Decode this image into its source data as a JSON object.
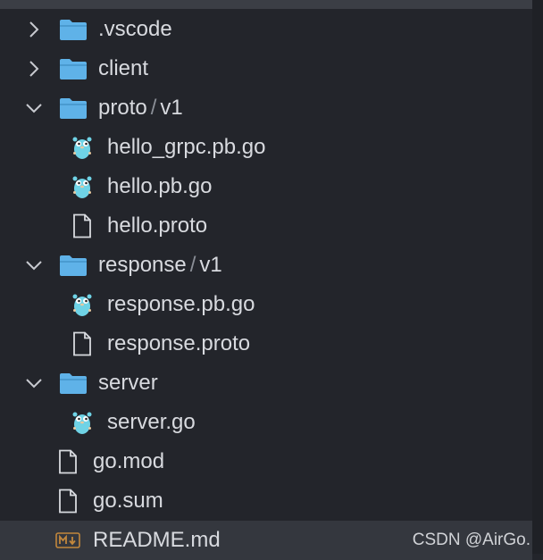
{
  "explorer": {
    "items": [
      {
        "label": ".vscode",
        "type": "folder",
        "expanded": false
      },
      {
        "label": "client",
        "type": "folder",
        "expanded": false
      },
      {
        "label": "proto",
        "sub": "v1",
        "type": "folder",
        "expanded": true
      },
      {
        "label": "hello_grpc.pb.go",
        "type": "go-file"
      },
      {
        "label": "hello.pb.go",
        "type": "go-file"
      },
      {
        "label": "hello.proto",
        "type": "file"
      },
      {
        "label": "response",
        "sub": "v1",
        "type": "folder",
        "expanded": true
      },
      {
        "label": "response.pb.go",
        "type": "go-file"
      },
      {
        "label": "response.proto",
        "type": "file"
      },
      {
        "label": "server",
        "type": "folder",
        "expanded": true
      },
      {
        "label": "server.go",
        "type": "go-file"
      },
      {
        "label": "go.mod",
        "type": "file"
      },
      {
        "label": "go.sum",
        "type": "file"
      },
      {
        "label": "README.md",
        "type": "markdown-file",
        "selected": true
      }
    ],
    "separator": "/"
  },
  "colors": {
    "folder": "#5fb2e8",
    "gopher": "#6fd3e6",
    "file_outline": "#d8dadf",
    "markdown": "#c2873c"
  },
  "watermark": "CSDN @AirGo."
}
